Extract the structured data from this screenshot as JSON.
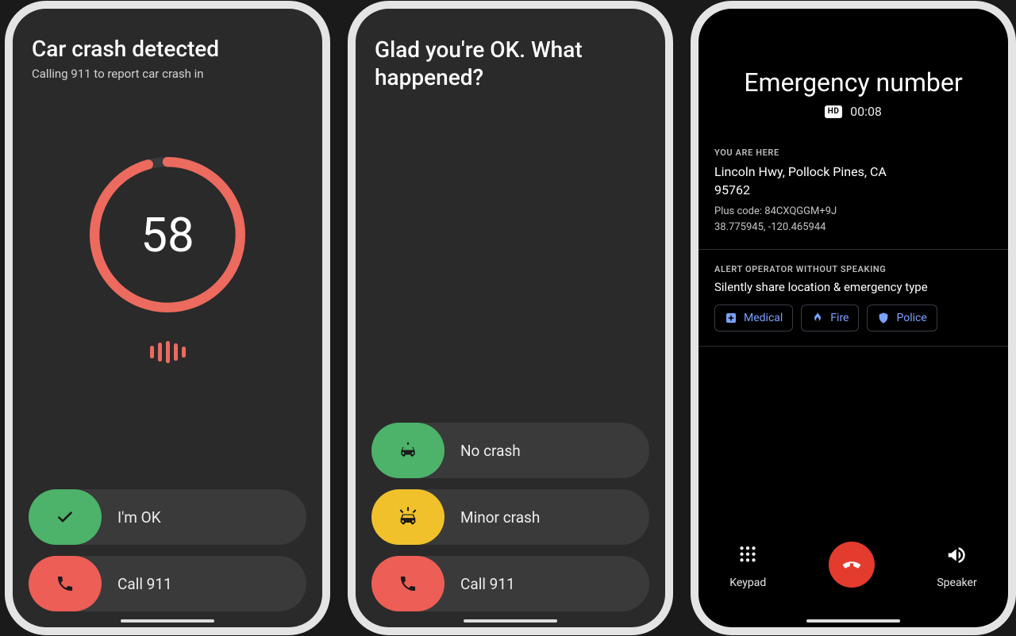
{
  "colors": {
    "green": "#4db36a",
    "red": "#ec5e56",
    "yellow": "#f0c12b",
    "ring": "#ec6a5e",
    "blue": "#7aa2ff"
  },
  "screen1": {
    "title": "Car crash detected",
    "subtitle": "Calling 911 to report car crash in",
    "countdown": "58",
    "progress_pct": 96,
    "buttons": {
      "ok": {
        "label": "I'm OK",
        "icon": "check-icon",
        "color": "green"
      },
      "call": {
        "label": "Call 911",
        "icon": "phone-icon",
        "color": "red"
      }
    }
  },
  "screen2": {
    "title": "Glad you're OK. What happened?",
    "buttons": {
      "no_crash": {
        "label": "No crash",
        "icon": "car-icon",
        "color": "green"
      },
      "minor": {
        "label": "Minor crash",
        "icon": "car-alert-icon",
        "color": "yellow"
      },
      "call": {
        "label": "Call 911",
        "icon": "phone-icon",
        "color": "red"
      }
    }
  },
  "screen3": {
    "title": "Emergency number",
    "hd_badge": "HD",
    "call_time": "00:08",
    "location": {
      "heading": "YOU ARE HERE",
      "address_line1": "Lincoln Hwy, Pollock Pines, CA",
      "address_line2": "95762",
      "plus_code": "Plus code: 84CXQGGM+9J",
      "coords": "38.775945, -120.465944"
    },
    "alert": {
      "heading": "ALERT OPERATOR WITHOUT SPEAKING",
      "subtitle": "Silently share location & emergency type",
      "chips": {
        "medical": "Medical",
        "fire": "Fire",
        "police": "Police"
      }
    },
    "controls": {
      "keypad": "Keypad",
      "speaker": "Speaker"
    }
  }
}
